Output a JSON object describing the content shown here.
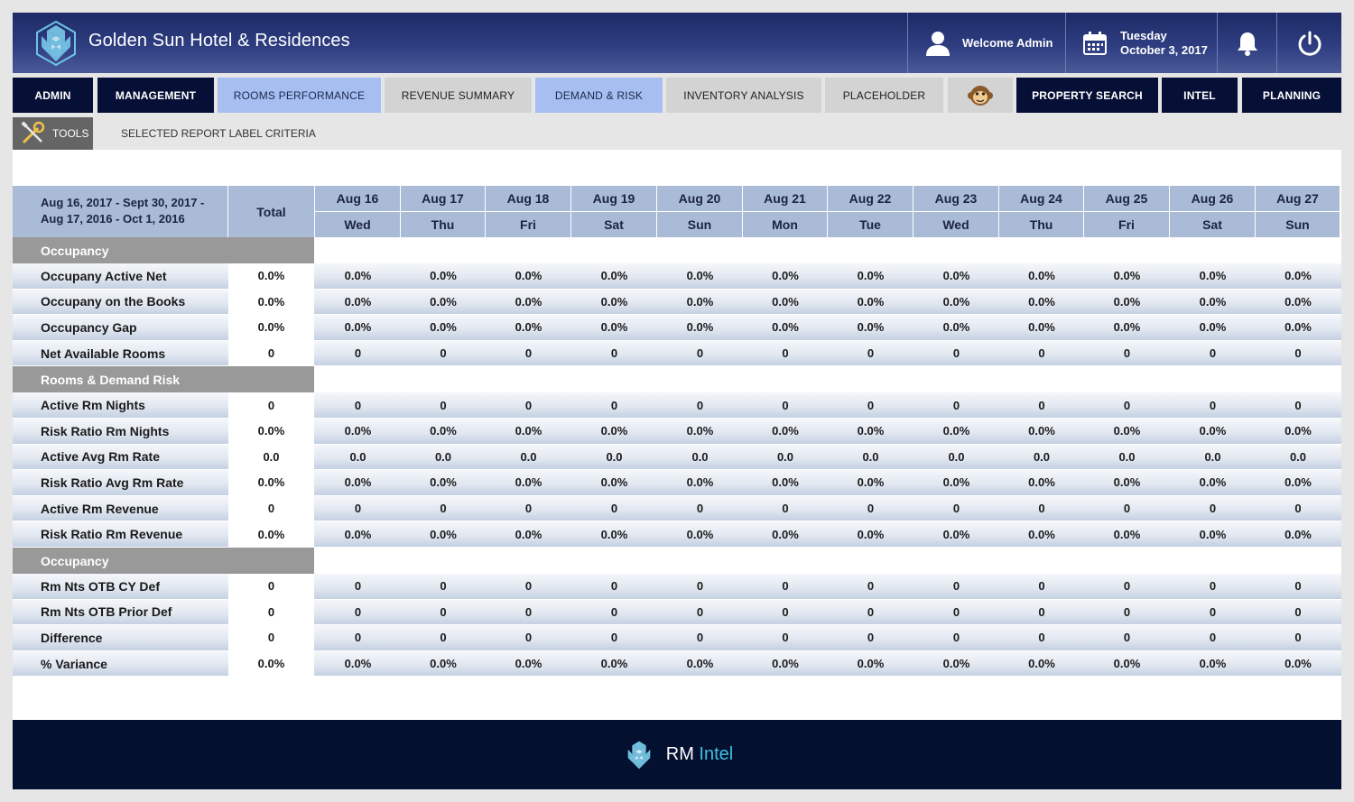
{
  "header": {
    "hotel_name": "Golden Sun Hotel & Residences",
    "welcome": "Welcome Admin",
    "day": "Tuesday",
    "date": "October 3, 2017"
  },
  "nav": [
    {
      "label": "ADMIN",
      "style": "dark"
    },
    {
      "label": "MANAGEMENT",
      "style": "dark"
    },
    {
      "label": "ROOMS PERFORMANCE",
      "style": "blue"
    },
    {
      "label": "REVENUE SUMMARY",
      "style": "gray"
    },
    {
      "label": "DEMAND & RISK",
      "style": "blue"
    },
    {
      "label": "INVENTORY ANALYSIS",
      "style": "gray"
    },
    {
      "label": "PLACEHOLDER",
      "style": "gray"
    },
    {
      "label": "",
      "style": "gray",
      "icon": "monkey-icon"
    },
    {
      "label": "PROPERTY SEARCH",
      "style": "dark"
    },
    {
      "label": "INTEL",
      "style": "dark"
    },
    {
      "label": "PLANNING",
      "style": "dark"
    }
  ],
  "tools": {
    "label": "TOOLS",
    "criteria": "SELECTED REPORT LABEL CRITERIA"
  },
  "table": {
    "range_line1": "Aug 16, 2017 - Sept 30, 2017 -",
    "range_line2": "Aug 17, 2016 - Oct 1, 2016",
    "total_label": "Total",
    "columns": [
      {
        "date": "Aug 16",
        "dow": "Wed"
      },
      {
        "date": "Aug 17",
        "dow": "Thu"
      },
      {
        "date": "Aug 18",
        "dow": "Fri"
      },
      {
        "date": "Aug 19",
        "dow": "Sat"
      },
      {
        "date": "Aug 20",
        "dow": "Sun"
      },
      {
        "date": "Aug 21",
        "dow": "Mon"
      },
      {
        "date": "Aug 22",
        "dow": "Tue"
      },
      {
        "date": "Aug 23",
        "dow": "Wed"
      },
      {
        "date": "Aug 24",
        "dow": "Thu"
      },
      {
        "date": "Aug 25",
        "dow": "Fri"
      },
      {
        "date": "Aug 26",
        "dow": "Sat"
      },
      {
        "date": "Aug 27",
        "dow": "Sun"
      }
    ],
    "sections": [
      {
        "title": "Occupancy",
        "rows": [
          {
            "label": "Occupany Active Net",
            "total": "0.0%",
            "value": "0.0%"
          },
          {
            "label": "Occupany on the Books",
            "total": "0.0%",
            "value": "0.0%"
          },
          {
            "label": "Occupancy Gap",
            "total": "0.0%",
            "value": "0.0%"
          },
          {
            "label": "Net Available Rooms",
            "total": "0",
            "value": "0"
          }
        ]
      },
      {
        "title": "Rooms & Demand Risk",
        "rows": [
          {
            "label": "Active Rm Nights",
            "total": "0",
            "value": "0"
          },
          {
            "label": "Risk Ratio Rm Nights",
            "total": "0.0%",
            "value": "0.0%"
          },
          {
            "label": "Active Avg Rm Rate",
            "total": "0.0",
            "value": "0.0"
          },
          {
            "label": "Risk Ratio Avg Rm Rate",
            "total": "0.0%",
            "value": "0.0%"
          },
          {
            "label": "Active Rm Revenue",
            "total": "0",
            "value": "0"
          },
          {
            "label": "Risk Ratio Rm Revenue",
            "total": "0.0%",
            "value": "0.0%"
          }
        ]
      },
      {
        "title": "Occupancy",
        "rows": [
          {
            "label": "Rm Nts OTB CY Def",
            "total": "0",
            "value": "0"
          },
          {
            "label": "Rm Nts OTB Prior Def",
            "total": "0",
            "value": "0"
          },
          {
            "label": "Difference",
            "total": "0",
            "value": "0"
          },
          {
            "label": "% Variance",
            "total": "0.0%",
            "value": "0.0%"
          }
        ]
      }
    ]
  },
  "footer": {
    "brand_a": "RM",
    "brand_b": "Intel"
  },
  "colors": {
    "header": "#2e3d80",
    "nav_dark": "#060f35",
    "nav_blue": "#a6bff0",
    "accent": "#3fc1e3",
    "table_header": "#a9bbd6"
  }
}
